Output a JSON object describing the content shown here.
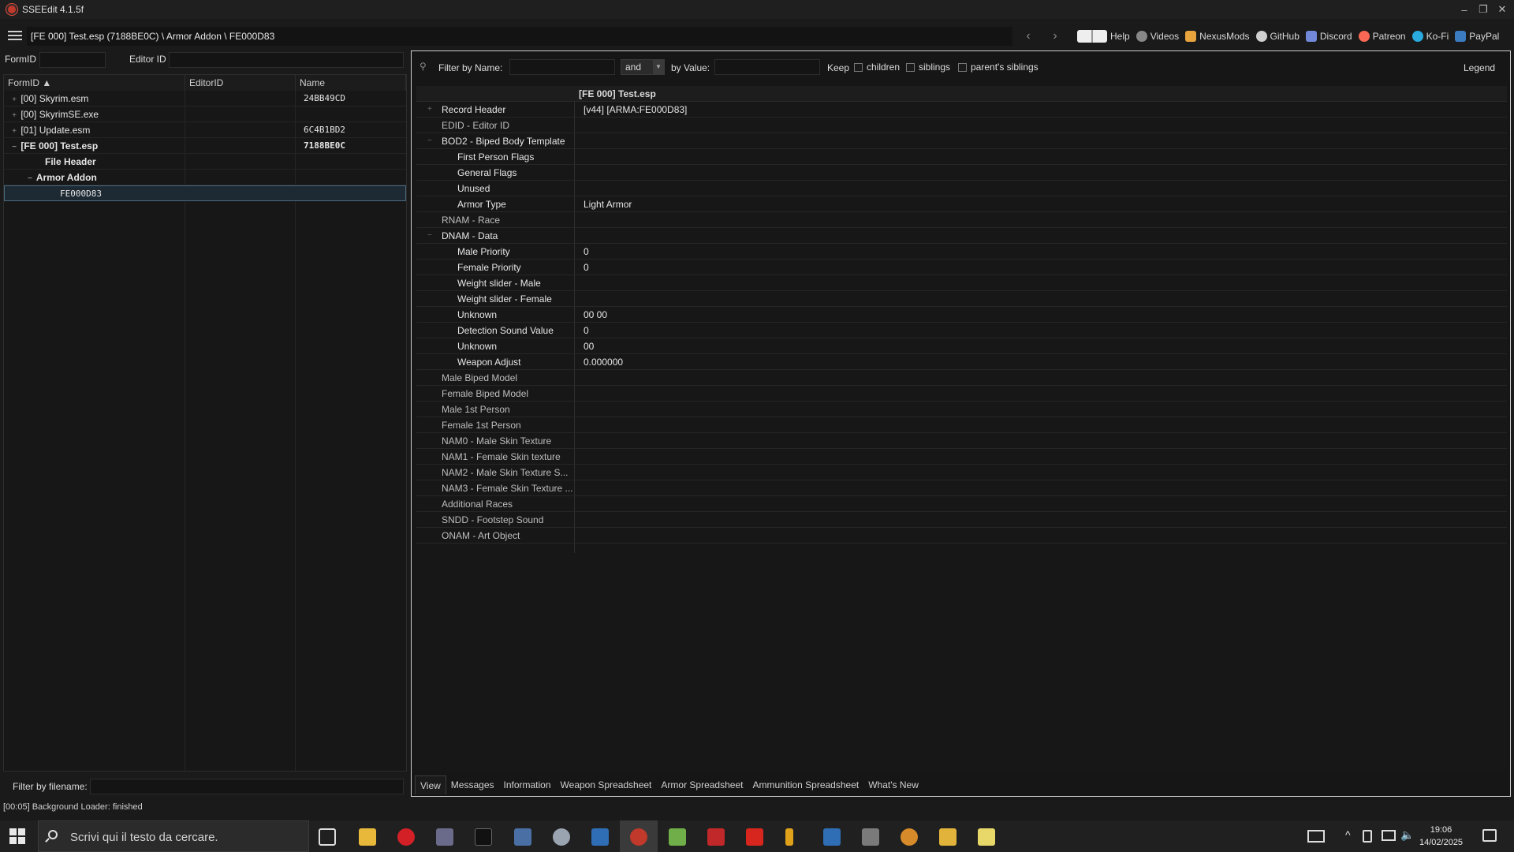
{
  "window": {
    "title": "SSEEdit 4.1.5f"
  },
  "path": {
    "text": "[FE 000] Test.esp (7188BE0C) \\ Armor Addon \\ FE000D83"
  },
  "links": [
    {
      "label": "Help",
      "icon": "book-icon",
      "color": "#e0e0e0"
    },
    {
      "label": "Videos",
      "icon": "videos-icon",
      "color": "#bbbbbb"
    },
    {
      "label": "NexusMods",
      "icon": "nexusmods-icon",
      "color": "#e8a33d"
    },
    {
      "label": "GitHub",
      "icon": "github-icon",
      "color": "#d0d0d0"
    },
    {
      "label": "Discord",
      "icon": "discord-icon",
      "color": "#7289da"
    },
    {
      "label": "Patreon",
      "icon": "patreon-icon",
      "color": "#f96854"
    },
    {
      "label": "Ko-Fi",
      "icon": "kofi-icon",
      "color": "#29abe0"
    },
    {
      "label": "PayPal",
      "icon": "paypal-icon",
      "color": "#3b7bbf"
    }
  ],
  "left": {
    "formid_label": "FormID",
    "editorid_label": "Editor ID",
    "columns": [
      "FormID",
      "EditorID",
      "Name"
    ],
    "tree": [
      {
        "label": "[00] Skyrim.esm",
        "name": "24BB49CD"
      },
      {
        "label": "[00] SkyrimSE.exe",
        "name": ""
      },
      {
        "label": "[01] Update.esm",
        "name": "6C4B1BD2"
      },
      {
        "label": "[FE 000] Test.esp",
        "name": "7188BE0C"
      },
      {
        "label": "File Header",
        "name": ""
      },
      {
        "label": "Armor Addon",
        "name": ""
      },
      {
        "label": "FE000D83",
        "name": ""
      }
    ],
    "filter_label": "Filter by filename:"
  },
  "right": {
    "filter_name_label": "Filter by Name:",
    "and_option": "and",
    "by_value_label": "by Value:",
    "keep_label": "Keep",
    "children_label": "children",
    "siblings_label": "siblings",
    "parent_siblings_label": "parent's siblings",
    "legend_label": "Legend",
    "column_header": "[FE 000] Test.esp",
    "rows": [
      {
        "name": "Record Header",
        "value": "[v44] [ARMA:FE000D83]"
      },
      {
        "name": "EDID - Editor ID",
        "value": ""
      },
      {
        "name": "BOD2 - Biped Body Template",
        "value": ""
      },
      {
        "name": "First Person Flags",
        "value": ""
      },
      {
        "name": "General Flags",
        "value": ""
      },
      {
        "name": "Unused",
        "value": ""
      },
      {
        "name": "Armor Type",
        "value": "Light Armor"
      },
      {
        "name": "RNAM - Race",
        "value": ""
      },
      {
        "name": "DNAM - Data",
        "value": ""
      },
      {
        "name": "Male Priority",
        "value": "0"
      },
      {
        "name": "Female Priority",
        "value": "0"
      },
      {
        "name": "Weight slider - Male",
        "value": ""
      },
      {
        "name": "Weight slider - Female",
        "value": ""
      },
      {
        "name": "Unknown",
        "value": "00 00"
      },
      {
        "name": "Detection Sound Value",
        "value": "0"
      },
      {
        "name": "Unknown",
        "value": "00"
      },
      {
        "name": "Weapon Adjust",
        "value": "0.000000"
      },
      {
        "name": "Male Biped Model",
        "value": ""
      },
      {
        "name": "Female Biped Model",
        "value": ""
      },
      {
        "name": "Male 1st Person",
        "value": ""
      },
      {
        "name": "Female 1st Person",
        "value": ""
      },
      {
        "name": "NAM0 - Male Skin Texture",
        "value": ""
      },
      {
        "name": "NAM1 - Female Skin texture",
        "value": ""
      },
      {
        "name": "NAM2 - Male Skin Texture S...",
        "value": ""
      },
      {
        "name": "NAM3 - Female Skin Texture ...",
        "value": ""
      },
      {
        "name": "Additional Races",
        "value": ""
      },
      {
        "name": "SNDD - Footstep Sound",
        "value": ""
      },
      {
        "name": "ONAM - Art Object",
        "value": ""
      }
    ],
    "tabs": [
      "View",
      "Messages",
      "Information",
      "Weapon Spreadsheet",
      "Armor Spreadsheet",
      "Ammunition Spreadsheet",
      "What's New"
    ]
  },
  "status": {
    "text": "[00:05] Background Loader: finished"
  },
  "taskbar": {
    "search_placeholder": "Scrivi qui il testo da cercare.",
    "time": "19:06",
    "date": "14/02/2025"
  }
}
